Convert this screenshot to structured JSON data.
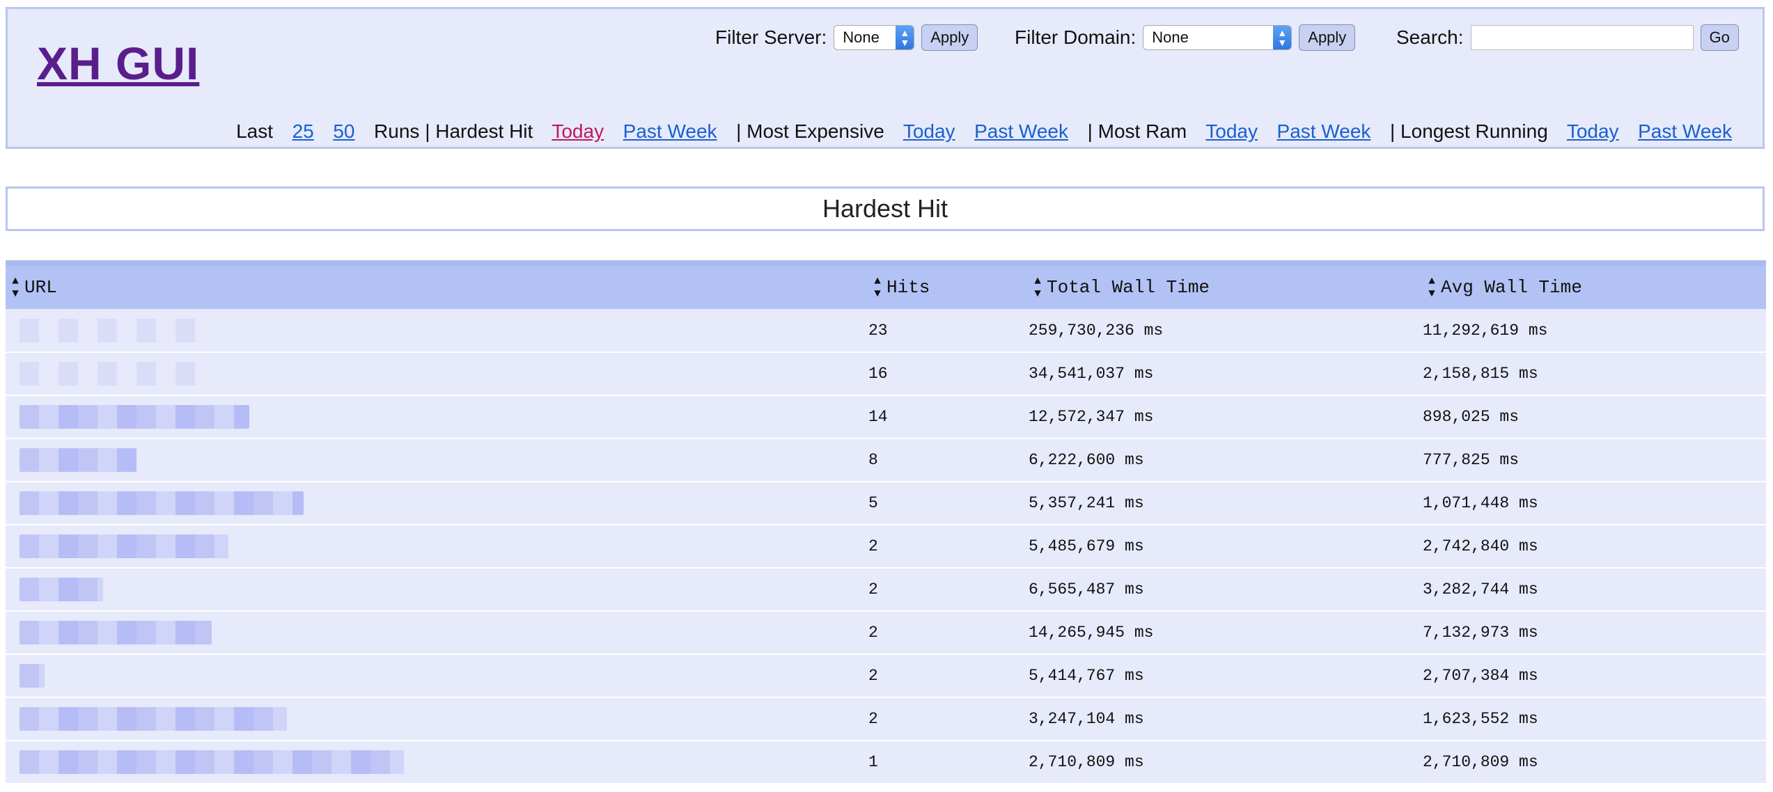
{
  "app": {
    "title": "XH GUI"
  },
  "filters": {
    "server_label": "Filter Server:",
    "server_value": "None",
    "domain_label": "Filter Domain:",
    "domain_value": "None",
    "apply_label": "Apply",
    "search_label": "Search:",
    "search_value": "",
    "go_label": "Go"
  },
  "nav": {
    "last": "Last",
    "runs_25": "25",
    "runs_50": "50",
    "runs": "Runs",
    "hardest_hit": "Hardest Hit",
    "most_expensive": "Most Expensive",
    "most_ram": "Most Ram",
    "longest_running": "Longest Running",
    "today": "Today",
    "past_week": "Past Week",
    "separator": "|"
  },
  "page": {
    "heading": "Hardest Hit"
  },
  "table": {
    "columns": [
      "URL",
      "Hits",
      "Total Wall Time",
      "Avg Wall Time"
    ],
    "rows": [
      {
        "hits": "23",
        "total": "259,730,236 ms",
        "avg": "11,292,619 ms",
        "url_redacted": 0.45,
        "tone": "light"
      },
      {
        "hits": "16",
        "total": "34,541,037 ms",
        "avg": "2,158,815 ms",
        "url_redacted": 0.45,
        "tone": "light"
      },
      {
        "hits": "14",
        "total": "12,572,347 ms",
        "avg": "898,025 ms",
        "url_redacted": 0.55,
        "tone": "dark"
      },
      {
        "hits": "8",
        "total": "6,222,600 ms",
        "avg": "777,825 ms",
        "url_redacted": 0.28,
        "tone": "dark"
      },
      {
        "hits": "5",
        "total": "5,357,241 ms",
        "avg": "1,071,448 ms",
        "url_redacted": 0.68,
        "tone": "dark"
      },
      {
        "hits": "2",
        "total": "5,485,679 ms",
        "avg": "2,742,840 ms",
        "url_redacted": 0.5,
        "tone": "dark"
      },
      {
        "hits": "2",
        "total": "6,565,487 ms",
        "avg": "3,282,744 ms",
        "url_redacted": 0.2,
        "tone": "dark"
      },
      {
        "hits": "2",
        "total": "14,265,945 ms",
        "avg": "7,132,973 ms",
        "url_redacted": 0.46,
        "tone": "dark"
      },
      {
        "hits": "2",
        "total": "5,414,767 ms",
        "avg": "2,707,384 ms",
        "url_redacted": 0.06,
        "tone": "dark"
      },
      {
        "hits": "2",
        "total": "3,247,104 ms",
        "avg": "1,623,552 ms",
        "url_redacted": 0.64,
        "tone": "dark"
      },
      {
        "hits": "1",
        "total": "2,710,809 ms",
        "avg": "2,710,809 ms",
        "url_redacted": 0.92,
        "tone": "dark"
      }
    ]
  }
}
